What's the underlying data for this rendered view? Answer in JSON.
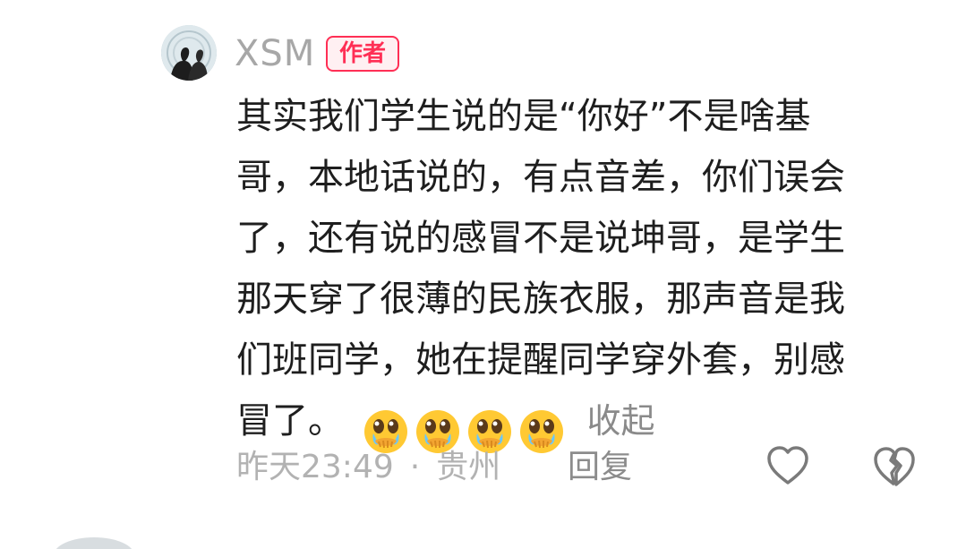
{
  "comment": {
    "author": {
      "name": "XSM",
      "badge": "作者",
      "badge_color": "#ff2f55"
    },
    "lines": [
      "其实我们学生说的是“你好”不是啥基",
      "哥，本地话说的，有点音差，你们误会",
      "了，还有说的感冒不是说坤哥，是学生",
      "那天穿了很薄的民族衣服，那声音是我",
      "们班同学，她在提醒同学穿外套，别感",
      "冒了。"
    ],
    "emojis": [
      "crying-face-emoji",
      "crying-face-emoji",
      "crying-face-emoji",
      "crying-face-emoji"
    ],
    "collapse_label": "收起",
    "time": "昨天23:49",
    "separator": "·",
    "location": "贵州",
    "reply_label": "回复",
    "icons": {
      "like": "heart-outline-icon",
      "dislike": "broken-heart-icon"
    }
  }
}
